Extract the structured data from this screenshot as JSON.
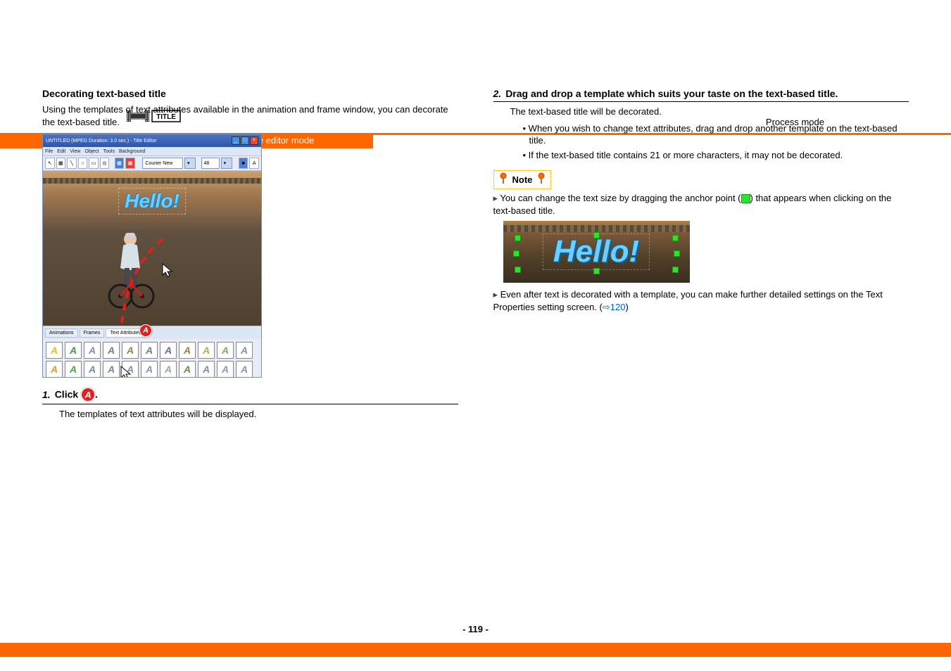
{
  "header": {
    "process_mode": "Process mode",
    "subtitle": "Title editor mode",
    "badge": "TITLE"
  },
  "left": {
    "heading": "Decorating text-based title",
    "intro": "Using the templates of text attributes available in the animation and frame window, you can decorate the text-based title.",
    "screenshot": {
      "titlebar": "UNTITLED (MPEG Duration: 3.0 sec.)  - Title Editor",
      "menu": [
        "File",
        "Edit",
        "View",
        "Object",
        "Tools",
        "Background"
      ],
      "font": "Courier New",
      "size": "48",
      "tabs": [
        "Animations",
        "Frames",
        "Text Attributes"
      ],
      "canvas_text": "Hello!"
    },
    "step1_num": "1.",
    "step1_title_a": "Click ",
    "step1_title_b": ".",
    "step1_body": "The templates of text attributes will be displayed."
  },
  "right": {
    "step2_num": "2.",
    "step2_title": "Drag and drop a template which suits your taste on the text-based title.",
    "step2_line1": "The text-based title will be decorated.",
    "step2_b1": "When you wish to change text attributes, drag and drop another template on the text-based title.",
    "step2_b2": "If the text-based title contains 21 or more characters, it may not be decorated.",
    "note_label": "Note",
    "note1a": "You can change the text size by dragging the anchor point (",
    "note1b": ") that appears when clicking on the text-based title.",
    "hello_text": "Hello!",
    "note2a": "Even after text is decorated with a template, you can make further detailed settings on the Text Properties setting screen. (",
    "note2_link": "120",
    "note2b": ")"
  },
  "page_number": "- 119 -"
}
